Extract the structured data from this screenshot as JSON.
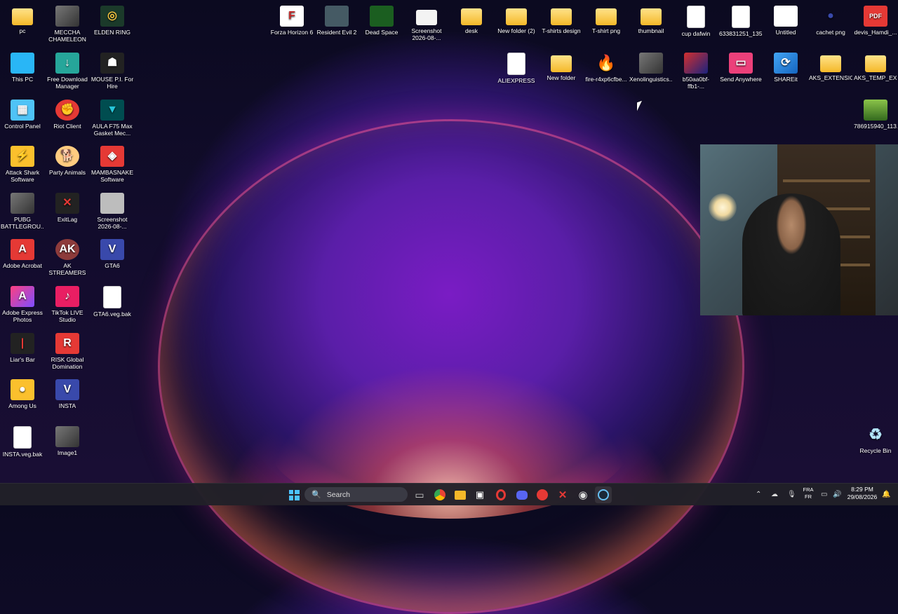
{
  "desktop": {
    "left_column_1": [
      "pc",
      "This PC",
      "Control Panel",
      "Attack Shark Software",
      "PUBG BATTLEGROU...",
      "Adobe Acrobat",
      "Adobe Express Photos",
      "Liar's Bar",
      "Among Us",
      "INSTA.veg.bak"
    ],
    "left_column_2": [
      "MECCHA CHAMELEON",
      "Free Download Manager",
      "Riot Client",
      "Party Animals",
      "ExitLag",
      "AK STREAMERS",
      "TikTok LIVE Studio",
      "RISK Global Domination",
      "INSTA",
      "Image1"
    ],
    "left_column_3": [
      "ELDEN RING",
      "MOUSE P.I. For Hire",
      "AULA F75 Max Gasket Mec...",
      "MAMBASNAKE Software",
      "Screenshot 2026-08-...",
      "GTA6",
      "GTA6.veg.bak"
    ],
    "top_row": [
      "Forza Horizon 6",
      "Resident Evil 2",
      "Dead Space",
      "Screenshot 2026-08-...",
      "desk",
      "New folder (2)",
      "T-shirts design",
      "T-shirt png",
      "thumbnail",
      "cup dafwin",
      "633831251_135...",
      "Untitled",
      "cachet png",
      "devis_Hamdi_..."
    ],
    "second_row": [
      "ALIEXPRESS",
      "New folder",
      "fire-r4xp6cfbe...",
      "Xenolinguistics...",
      "b50aa0bf-ffb1-...",
      "Send Anywhere",
      "SHAREit",
      "AKS_EXTENSIO...",
      "AKS_TEMP_EX..."
    ],
    "right_single": "786915940_113...",
    "recycle_bin": "Recycle Bin"
  },
  "taskbar": {
    "search_label": "Search",
    "language_top": "FRA",
    "language_bottom": "FR",
    "time": "8:29 PM",
    "date": "29/08/2026"
  },
  "colors": {
    "taskbar_bg": "#202028",
    "accent": "#4cc2ff"
  }
}
